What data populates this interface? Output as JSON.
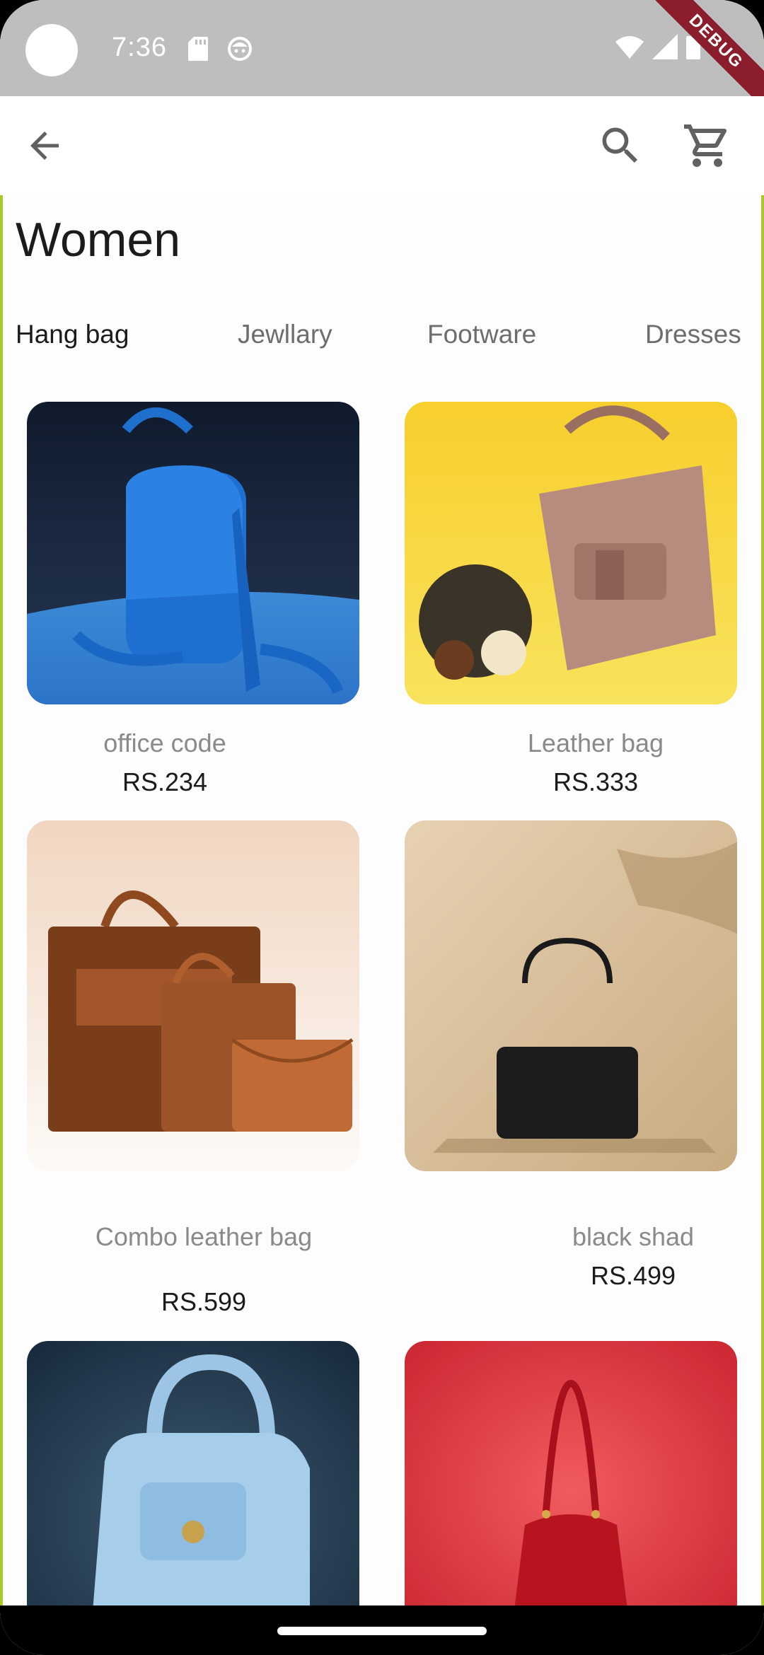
{
  "status_bar": {
    "time": "7:36",
    "icons_left": [
      "sd-card-icon",
      "face-icon"
    ],
    "icons_right": [
      "wifi-icon",
      "cellular-icon",
      "battery-icon"
    ],
    "debug_label": "DEBUG"
  },
  "app_bar": {
    "back_icon": "arrow-back-icon",
    "search_icon": "search-icon",
    "cart_icon": "shopping-cart-icon"
  },
  "page": {
    "title": "Women"
  },
  "tabs": [
    {
      "label": "Hang bag",
      "active": true
    },
    {
      "label": "Jewllary",
      "active": false
    },
    {
      "label": "Footware",
      "active": false
    },
    {
      "label": "Dresses",
      "active": false
    }
  ],
  "products": [
    {
      "name": "office code",
      "price": "RS.234"
    },
    {
      "name": "Leather bag",
      "price": "RS.333"
    },
    {
      "name": "Combo leather bag",
      "price": "RS.599"
    },
    {
      "name": "black shad",
      "price": "RS.499"
    },
    {
      "name": "",
      "price": ""
    },
    {
      "name": "",
      "price": ""
    }
  ],
  "colors": {
    "status_bar_bg": "#bebebe",
    "debug_ribbon": "#8b1d2c",
    "text_primary": "#1b1b1b",
    "text_secondary": "#8a8a8a"
  }
}
